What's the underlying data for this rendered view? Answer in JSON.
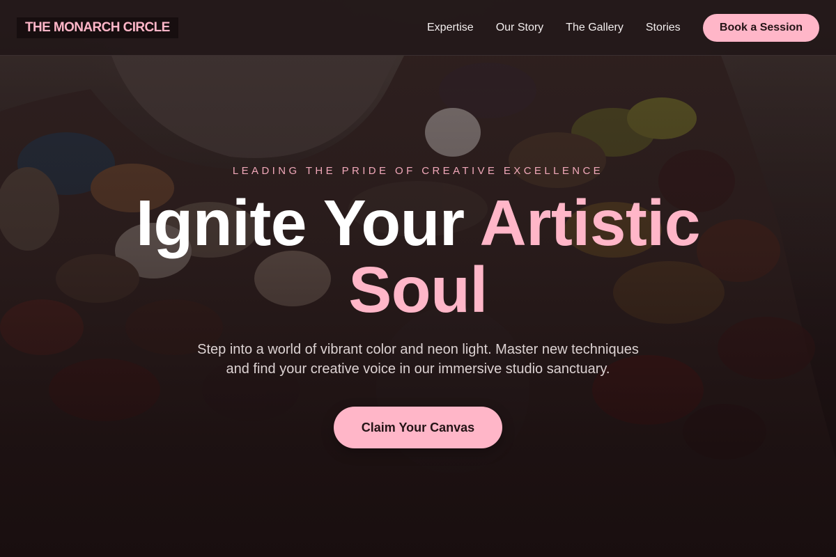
{
  "brand": {
    "name": "THE MONARCH CIRCLE"
  },
  "nav": {
    "links": [
      "Expertise",
      "Our Story",
      "The Gallery",
      "Stories"
    ],
    "cta_label": "Book a Session"
  },
  "hero": {
    "eyebrow": "LEADING THE PRIDE OF CREATIVE EXCELLENCE",
    "headline_white": "Ignite Your",
    "headline_pink_1": "Artistic",
    "headline_pink_2": "Soul",
    "subtext_line1": "Step into a world of vibrant color and neon light. Master new techniques",
    "subtext_line2": "and find your creative voice in our immersive studio sanctuary.",
    "cta_label": "Claim Your Canvas",
    "background_image": "paint-palette-image"
  },
  "colors": {
    "accent_pink": "#ffb6c8",
    "nav_bg": "#221819",
    "page_bg": "#1b1213",
    "text_light": "#f3eeee"
  }
}
